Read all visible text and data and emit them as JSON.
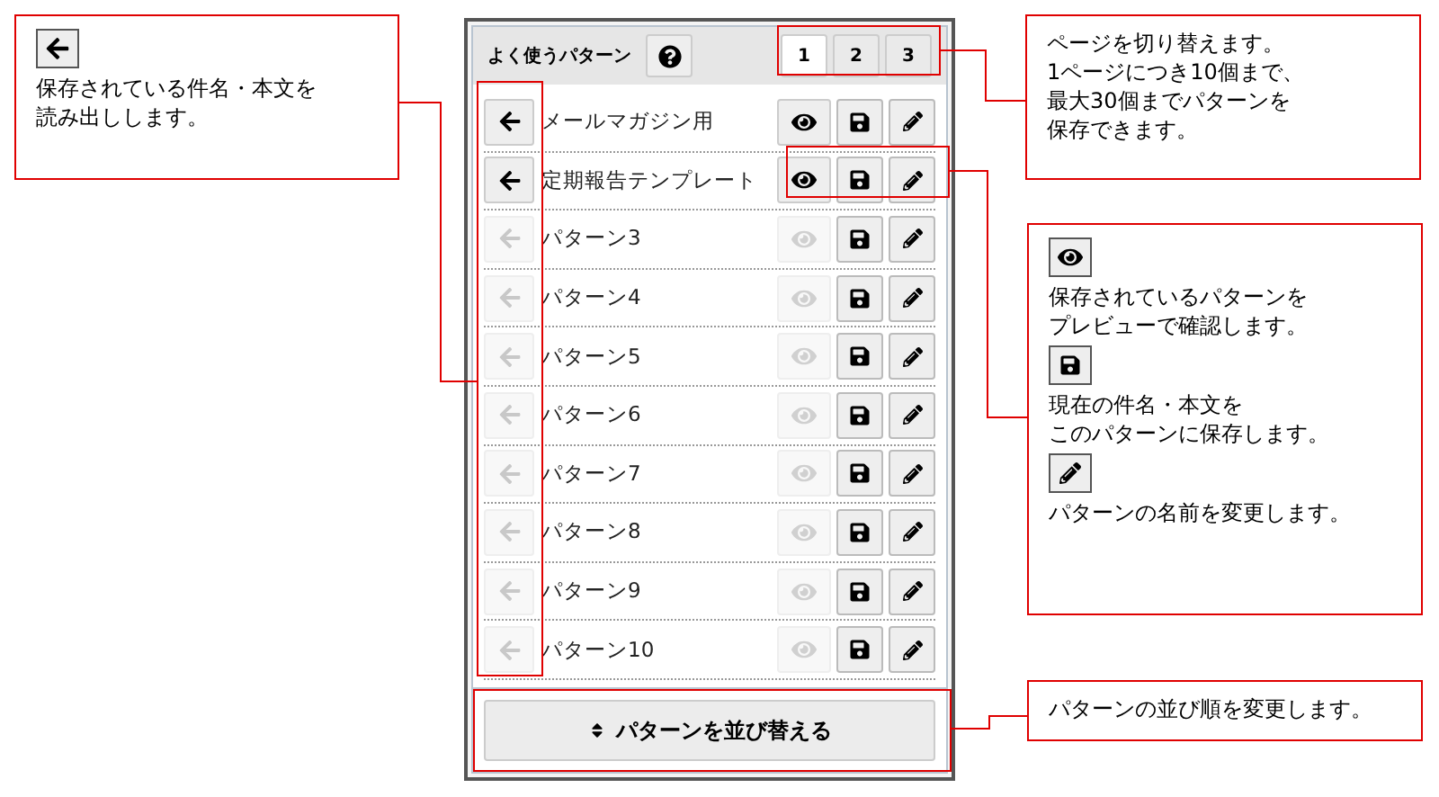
{
  "panel": {
    "title": "よく使うパターン",
    "page_tabs": [
      {
        "label": "1",
        "selected": true
      },
      {
        "label": "2",
        "selected": false
      },
      {
        "label": "3",
        "selected": false
      }
    ],
    "patterns": [
      {
        "name": "メールマガジン用",
        "saved": true
      },
      {
        "name": "定期報告テンプレート",
        "saved": true
      },
      {
        "name": "パターン3",
        "saved": false
      },
      {
        "name": "パターン4",
        "saved": false
      },
      {
        "name": "パターン5",
        "saved": false
      },
      {
        "name": "パターン6",
        "saved": false
      },
      {
        "name": "パターン7",
        "saved": false
      },
      {
        "name": "パターン8",
        "saved": false
      },
      {
        "name": "パターン9",
        "saved": false
      },
      {
        "name": "パターン10",
        "saved": false
      }
    ],
    "sort_button": "パターンを並び替える"
  },
  "callouts": [
    {
      "items": [
        {
          "kind": "load",
          "lines": [
            "保存されている件名・本文を",
            "読み出しします。"
          ]
        }
      ]
    },
    {
      "items": [
        {
          "kind": "text",
          "lines": [
            "ページを切り替えます。",
            "1ページにつき10個まで、",
            "最大30個までパターンを",
            "保存できます。"
          ]
        }
      ]
    },
    {
      "items": [
        {
          "kind": "preview",
          "lines": [
            "保存されているパターンを",
            "プレビューで確認します。"
          ]
        },
        {
          "kind": "save",
          "lines": [
            "現在の件名・本文を",
            "このパターンに保存します。"
          ]
        },
        {
          "kind": "rename",
          "lines": [
            "パターンの名前を変更します。"
          ]
        }
      ]
    },
    {
      "items": [
        {
          "kind": "text",
          "lines": [
            "パターンの並び順を変更します。"
          ]
        }
      ]
    }
  ]
}
